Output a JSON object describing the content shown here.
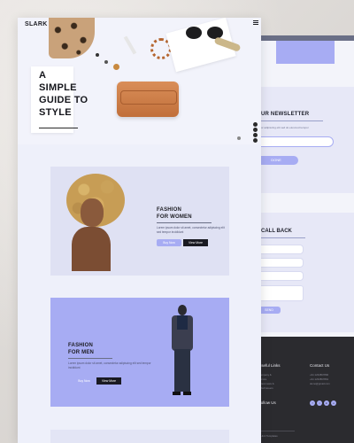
{
  "brand": {
    "logo": "SLARK"
  },
  "hero": {
    "title_lines": [
      "A",
      "SIMPLE",
      "GUIDE TO",
      "STYLE"
    ]
  },
  "cards": {
    "women": {
      "title_lines": [
        "FASHION",
        "FOR WOMEN"
      ],
      "text": "Lorem ipsum dolor sit amet, consectetur adipiscing elit sed tempor incididunt",
      "btn_outline": "Buy Now",
      "btn_dark": "View More"
    },
    "men": {
      "title_lines": [
        "FASHION",
        "FOR MEN"
      ],
      "text": "Lorem ipsum dolor sit amet, consectetur adipiscing elit sed tempor incididunt",
      "btn_outline": "Buy Now",
      "btn_dark": "View More"
    }
  },
  "back_page": {
    "newsletter": {
      "title": "UR NEWSLETTER",
      "text": "or adipiscing elit sed do eiusmod tempor",
      "button": "DONE"
    },
    "call_back": {
      "title": "CALL BACK",
      "button": "SEND"
    },
    "footer": {
      "useful_links": "Useful Links",
      "contact_us": "Contact Us",
      "follow_us": "Follow Us",
      "links": [
        "Company &",
        "Service",
        "Latest news &",
        "Jobs/Careers"
      ],
      "contacts": [
        "+91 1234567890",
        "+91 1234567891",
        "demo@gmail.com"
      ],
      "copyright": "Crafted Free Html Templates"
    }
  }
}
